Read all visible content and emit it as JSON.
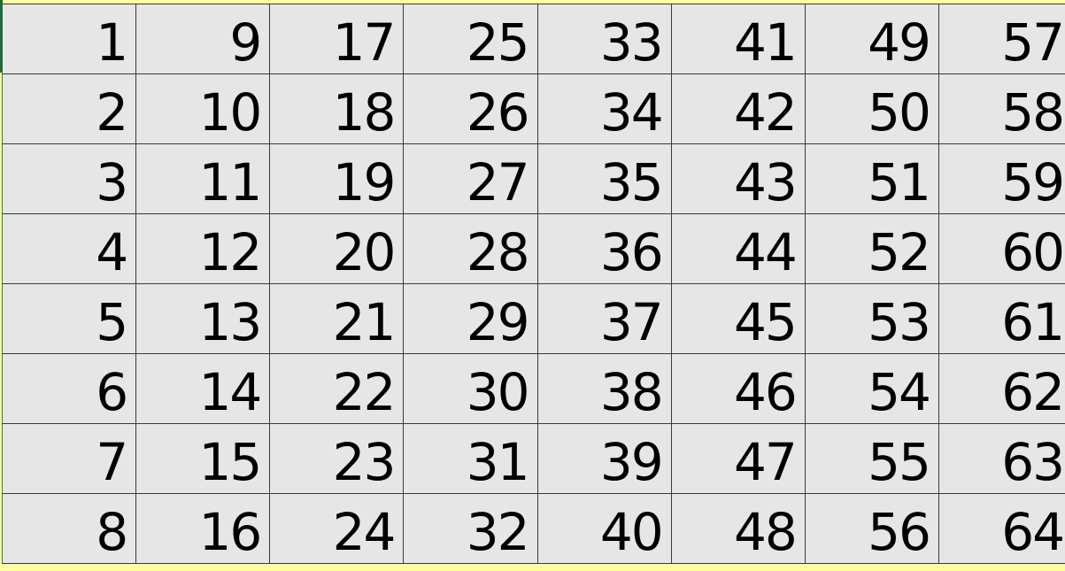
{
  "grid": {
    "rows": [
      [
        "1",
        "9",
        "17",
        "25",
        "33",
        "41",
        "49",
        "57"
      ],
      [
        "2",
        "10",
        "18",
        "26",
        "34",
        "42",
        "50",
        "58"
      ],
      [
        "3",
        "11",
        "19",
        "27",
        "35",
        "43",
        "51",
        "59"
      ],
      [
        "4",
        "12",
        "20",
        "28",
        "36",
        "44",
        "52",
        "60"
      ],
      [
        "5",
        "13",
        "21",
        "29",
        "37",
        "45",
        "53",
        "61"
      ],
      [
        "6",
        "14",
        "22",
        "30",
        "38",
        "46",
        "54",
        "62"
      ],
      [
        "7",
        "15",
        "23",
        "31",
        "39",
        "47",
        "55",
        "63"
      ],
      [
        "8",
        "16",
        "24",
        "32",
        "40",
        "48",
        "56",
        "64"
      ]
    ]
  },
  "colors": {
    "cell_background": "#e6e6e6",
    "sheet_background": "#ffff9e",
    "gridline": "#3a3a3a",
    "active_cell_marker": "#1f6b3a"
  }
}
